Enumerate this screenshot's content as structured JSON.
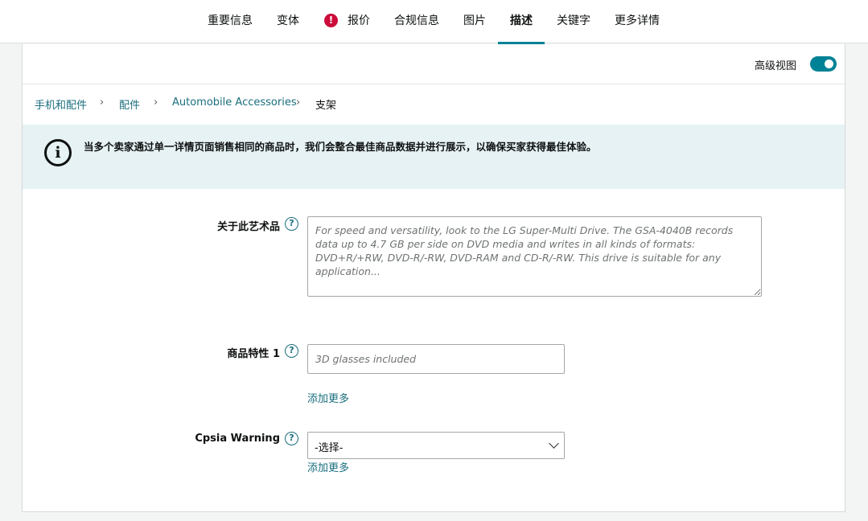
{
  "tabs": [
    {
      "label": "重要信息"
    },
    {
      "label": "变体"
    },
    {
      "label": "报价",
      "alert": "!"
    },
    {
      "label": "合规信息"
    },
    {
      "label": "图片"
    },
    {
      "label": "描述",
      "active": true
    },
    {
      "label": "关键字"
    },
    {
      "label": "更多详情"
    }
  ],
  "header": {
    "advanced_view_label": "高级视图",
    "advanced_view_on": true
  },
  "breadcrumb": {
    "items": [
      "手机和配件",
      "配件",
      "Automobile Accessories",
      "支架"
    ],
    "separator": "›"
  },
  "banner": {
    "icon": "info-icon",
    "icon_glyph": "i",
    "text": "当多个卖家通过单一详情页面销售相同的商品时，我们会整合最佳商品数据并进行展示，以确保买家获得最佳体验。"
  },
  "fields": {
    "about": {
      "label": "关于此艺术品",
      "help": "?",
      "placeholder": "For speed and versatility, look to the LG Super-Multi Drive. The GSA-4040B records data up to 4.7 GB per side on DVD media and writes in all kinds of formats: DVD+R/+RW, DVD-R/-RW, DVD-RAM and CD-R/-RW. This drive is suitable for any application..."
    },
    "feature1": {
      "label": "商品特性 1",
      "help": "?",
      "placeholder": "3D glasses included",
      "add_more": "添加更多"
    },
    "cpsia": {
      "label": "Cpsia Warning",
      "help": "?",
      "selected": "-选择-",
      "add_more": "添加更多"
    }
  },
  "colors": {
    "accent": "#008296",
    "link": "#1a6e7e",
    "alert": "#cc0c39",
    "banner_bg": "#e6f2f4"
  }
}
